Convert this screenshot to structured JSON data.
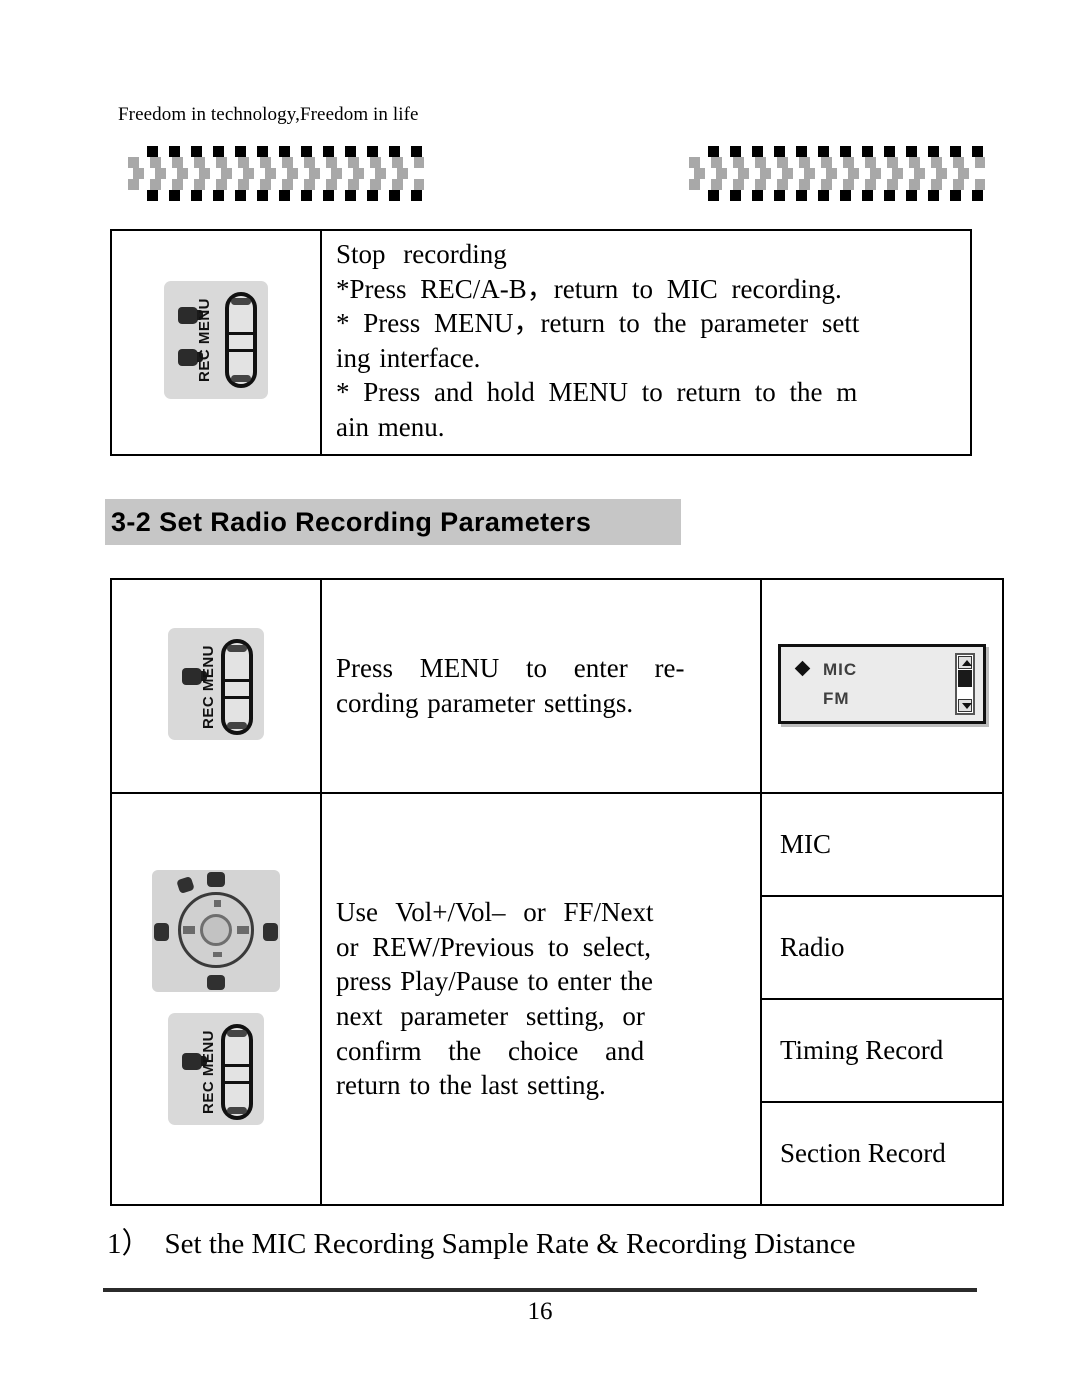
{
  "header": {
    "running_text": "Freedom in technology,Freedom in life"
  },
  "decoration": {
    "left_bar_icon": "checkered-bar",
    "right_bar_icon": "checkered-bar"
  },
  "table_stop_recording": {
    "device_image": {
      "icon": "rec-menu-button-device",
      "label": "REC MENU",
      "buttons": 2
    },
    "lines": [
      "Stop recording",
      "*Press REC/A-B，return to MIC recording.",
      "* Press MENU，return to the parameter sett",
      "ing interface.",
      "* Press and hold MENU to return to the m",
      "ain menu."
    ]
  },
  "section": {
    "heading": "3-2 Set Radio Recording Parameters"
  },
  "table_recording_params": {
    "row1": {
      "device_image": {
        "icon": "rec-menu-button-device",
        "label": "REC MENU",
        "buttons": 1
      },
      "lines": [
        "Press MENU to enter re-",
        "cording parameter settings."
      ],
      "lcd": {
        "selected_bullet": "diamond",
        "items": [
          "MIC",
          "FM"
        ],
        "scrollbar": {
          "up_arrow": "▲",
          "down_arrow": "▼"
        }
      }
    },
    "row2": {
      "device_image_navpad": {
        "icon": "navigation-pad-device"
      },
      "device_image_recmenu": {
        "icon": "rec-menu-button-device",
        "label": "REC MENU",
        "buttons": 1
      },
      "lines": [
        "Use Vol+/Vol– or FF/Next",
        "or REW/Previous to select,",
        "press Play/Pause to enter the",
        "next parameter setting, or",
        "confirm the choice and",
        "return to the last setting."
      ],
      "menu_items": [
        "MIC",
        "Radio",
        "Timing Record",
        "Section Record"
      ]
    }
  },
  "footnote": {
    "number": "1）",
    "text": "Set the MIC Recording Sample Rate & Recording Distance"
  },
  "footer": {
    "page_number": "16"
  },
  "colors": {
    "heading_background": "#c6c6c6",
    "table_border": "#000000",
    "device_background": "#d9d9d9",
    "checker_dark": "#000000",
    "checker_gray": "#a8a8a8"
  }
}
